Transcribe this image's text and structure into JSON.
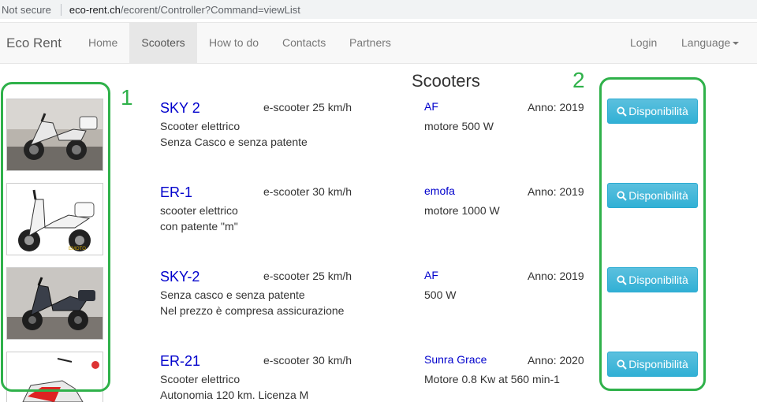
{
  "address_bar": {
    "security": "Not secure",
    "url_host": "eco-rent.ch",
    "url_path": "/ecorent/Controller?Command=viewList"
  },
  "navbar": {
    "brand": "Eco Rent",
    "items": [
      "Home",
      "Scooters",
      "How to do",
      "Contacts",
      "Partners"
    ],
    "login": "Login",
    "language": "Language"
  },
  "page": {
    "title": "Scooters"
  },
  "annotations": {
    "left": "1",
    "right": "2",
    "color": "#2fb14a"
  },
  "button_label": "Disponibilità",
  "scooters": [
    {
      "name": "SKY 2",
      "speed": "e-scooter 25 km/h",
      "desc1": "Scooter elettrico",
      "desc2": "Senza Casco e senza patente",
      "brand": "AF",
      "motor": "motore 500 W",
      "year": "Anno: 2019"
    },
    {
      "name": "ER-1",
      "speed": "e-scooter 30 km/h",
      "desc1": "scooter elettrico",
      "desc2": "con patente \"m\"",
      "brand": "emofa",
      "motor": "motore 1000 W",
      "year": "Anno: 2019"
    },
    {
      "name": "SKY-2",
      "speed": "e-scooter 25 km/h",
      "desc1": "Senza casco e senza patente",
      "desc2": "Nel prezzo è compresa assicurazione",
      "brand": "AF",
      "motor": "500 W",
      "year": "Anno: 2019"
    },
    {
      "name": "ER-21",
      "speed": "e-scooter 30 km/h",
      "desc1": "Scooter elettrico",
      "desc2": "Autonomia 120 km. Licenza M",
      "brand": "Sunra Grace",
      "motor": "Motore 0.8 Kw at 560 min-1",
      "year": "Anno: 2020"
    }
  ]
}
